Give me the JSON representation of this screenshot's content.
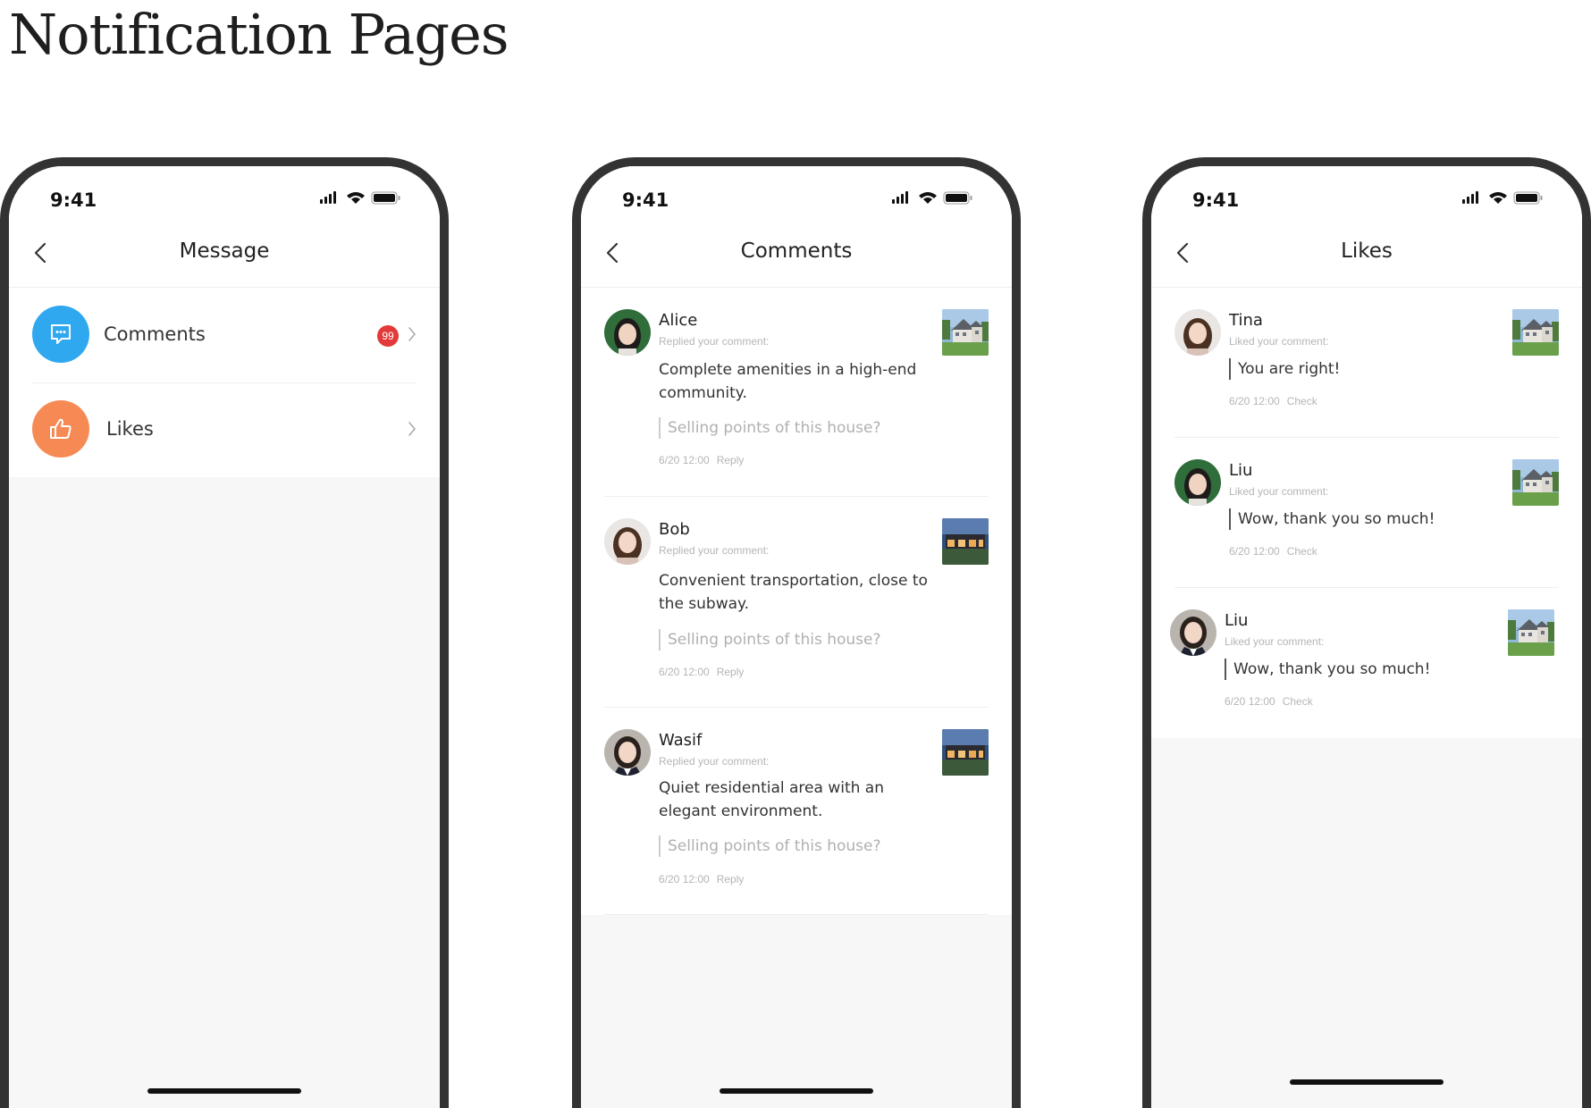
{
  "title": "Notification Pages",
  "status": {
    "time": "9:41"
  },
  "colors": {
    "comments_icon": "#2fa8f0",
    "likes_icon": "#f68a55",
    "badge": "#e23a3a"
  },
  "message_screen": {
    "nav_title": "Message",
    "rows": [
      {
        "label": "Comments",
        "badge": "99",
        "icon": "chat-bubble-icon"
      },
      {
        "label": "Likes",
        "icon": "thumbs-up-icon"
      }
    ]
  },
  "comments_screen": {
    "nav_title": "Comments",
    "items": [
      {
        "name": "Alice",
        "action": "Replied your comment:",
        "text": "Complete amenities in a high-end community.",
        "quote": "Selling points of this house?",
        "time": "6/20 12:00",
        "link": "Reply"
      },
      {
        "name": "Bob",
        "action": "Replied your comment:",
        "text": "Convenient transportation, close to the subway.",
        "quote": "Selling points of this house?",
        "time": "6/20 12:00",
        "link": "Reply"
      },
      {
        "name": "Wasif",
        "action": "Replied your comment:",
        "text": "Quiet residential area with an elegant environment.",
        "quote": "Selling points of this house?",
        "time": "6/20 12:00",
        "link": "Reply"
      }
    ]
  },
  "likes_screen": {
    "nav_title": "Likes",
    "items": [
      {
        "name": "Tina",
        "action": "Liked your comment:",
        "quote": "You are right!",
        "time": "6/20 12:00",
        "link": "Check"
      },
      {
        "name": "Liu",
        "action": "Liked your comment:",
        "quote": "Wow, thank you so much!",
        "time": "6/20 12:00",
        "link": "Check"
      },
      {
        "name": "Liu",
        "action": "Liked your comment:",
        "quote": "Wow, thank you so much!",
        "time": "6/20 12:00",
        "link": "Check"
      }
    ]
  }
}
